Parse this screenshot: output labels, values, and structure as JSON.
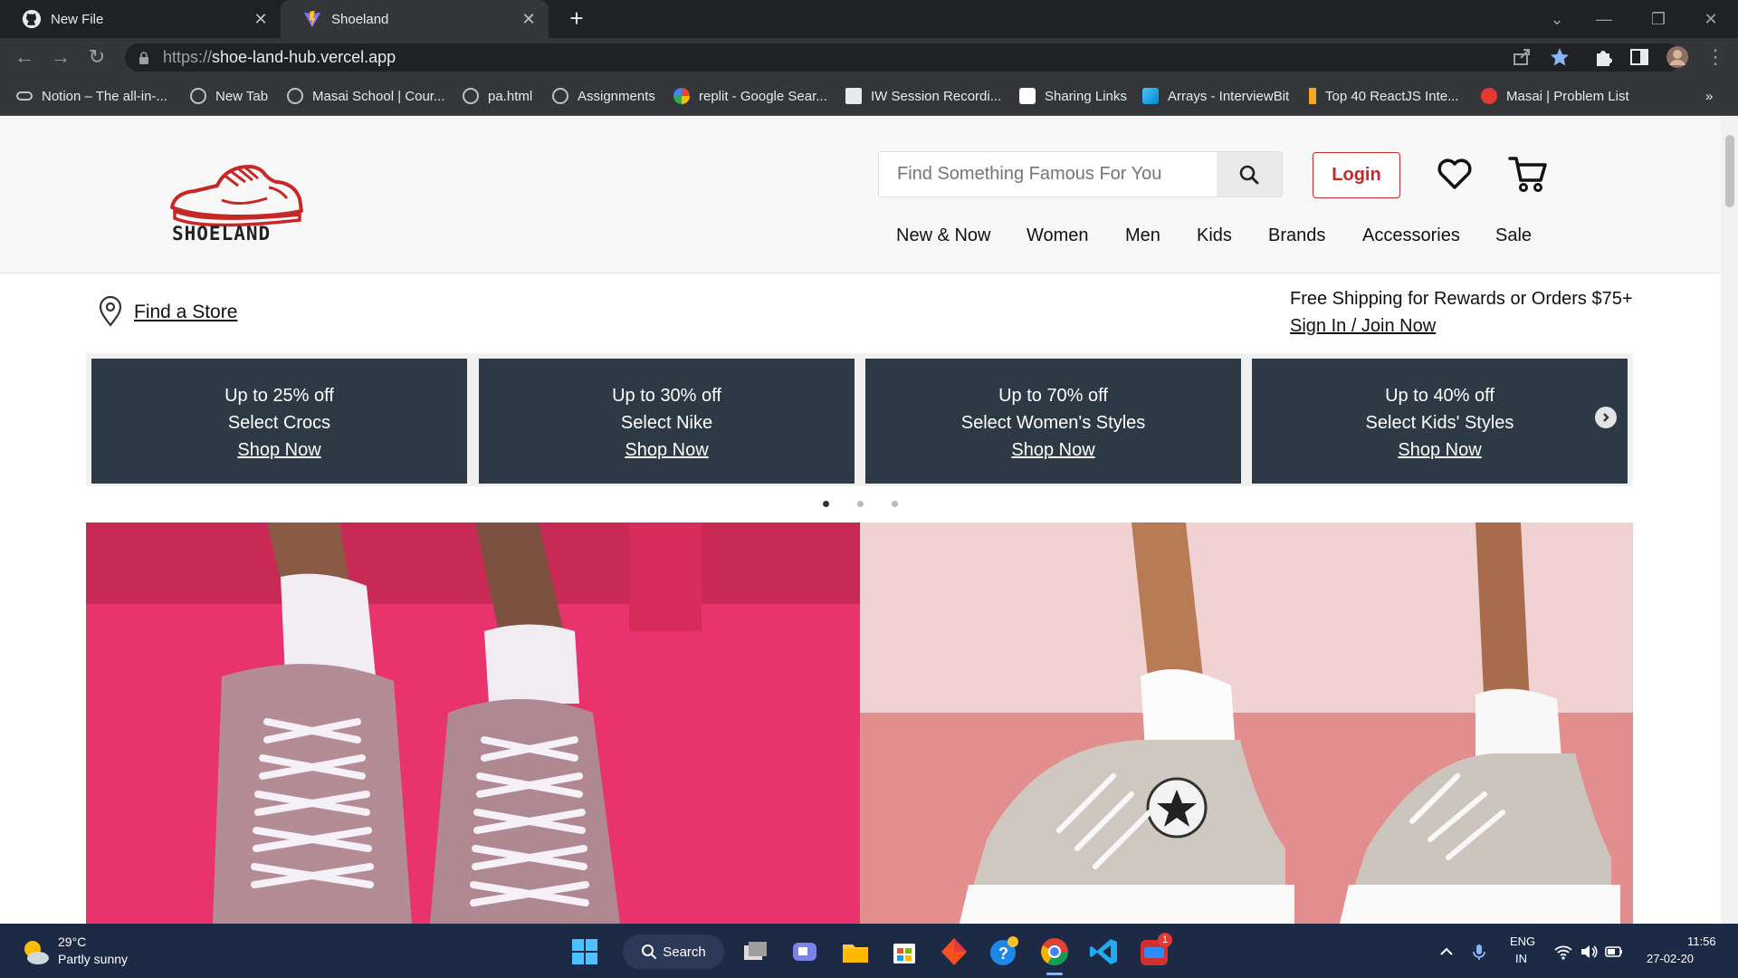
{
  "browser": {
    "tabs": [
      {
        "title": "New File",
        "icon": "github-icon",
        "active": false
      },
      {
        "title": "Shoeland",
        "icon": "vite-icon",
        "active": true
      }
    ],
    "new_tab": "+",
    "url_scheme": "https://",
    "url_host": "shoe-land-hub.vercel.app",
    "bookmarks": [
      {
        "label": "Notion – The all-in-...",
        "icon": "link-icon"
      },
      {
        "label": "New Tab",
        "icon": "globe-icon"
      },
      {
        "label": "Masai School | Cour...",
        "icon": "globe-icon"
      },
      {
        "label": "pa.html",
        "icon": "globe-icon"
      },
      {
        "label": "Assignments",
        "icon": "globe-icon"
      },
      {
        "label": "replit - Google Sear...",
        "icon": "google-icon"
      },
      {
        "label": "IW Session Recordi...",
        "icon": "doc-icon"
      },
      {
        "label": "Sharing Links",
        "icon": "notion-icon"
      },
      {
        "label": "Arrays - InterviewBit",
        "icon": "interviewbit-icon"
      },
      {
        "label": "Top 40 ReactJS Inte...",
        "icon": "bookmark-icon"
      },
      {
        "label": "Masai | Problem List",
        "icon": "masai-icon"
      }
    ],
    "bookmarks_overflow": "»"
  },
  "site": {
    "logo_text": "SHOELAND",
    "search_placeholder": "Find Something Famous For You",
    "login_label": "Login",
    "nav": [
      "New & Now",
      "Women",
      "Men",
      "Kids",
      "Brands",
      "Accessories",
      "Sale"
    ],
    "find_store": "Find a Store",
    "shipping_text": "Free Shipping for Rewards or Orders $75+",
    "signin_text": "Sign In / Join Now",
    "promos": [
      {
        "line1": "Up to 25% off",
        "line2": "Select Crocs",
        "cta": "Shop Now"
      },
      {
        "line1": "Up to 30% off",
        "line2": "Select Nike",
        "cta": "Shop Now"
      },
      {
        "line1": "Up to 70% off",
        "line2": "Select Women's Styles",
        "cta": "Shop Now"
      },
      {
        "line1": "Up to 40% off",
        "line2": "Select Kids' Styles",
        "cta": "Shop Now"
      }
    ],
    "carousel_active_index": 0,
    "carousel_count": 3,
    "colors": {
      "promo_bg": "#2d3a45",
      "login_red": "#c62828"
    }
  },
  "taskbar": {
    "weather_temp": "29°C",
    "weather_desc": "Partly sunny",
    "search_label": "Search",
    "apps": [
      "start-icon",
      "task-view-icon",
      "teams-chat-icon",
      "file-explorer-icon",
      "ms-store-icon",
      "app-red-icon",
      "help-icon",
      "chrome-icon",
      "vscode-icon",
      "zoom-icon"
    ],
    "zoom_badge": "1",
    "lang_line1": "ENG",
    "lang_line2": "IN",
    "time": "11:56",
    "date": "27-02-20"
  }
}
